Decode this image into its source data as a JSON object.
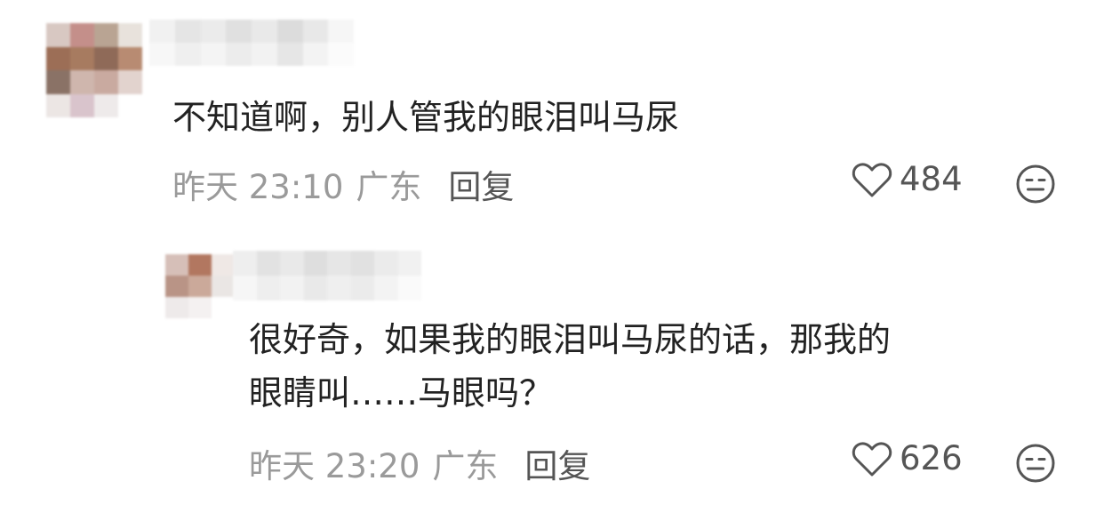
{
  "comments": [
    {
      "text": "不知道啊，别人管我的眼泪叫马尿",
      "time": "昨天 23:10",
      "location": "广东",
      "reply_label": "回复",
      "likes": "484"
    },
    {
      "text_line1": "很好奇，如果我的眼泪叫马尿的话，那我的",
      "text_line2": "眼睛叫……马眼吗？",
      "time": "昨天 23:20",
      "location": "广东",
      "reply_label": "回复",
      "likes": "626"
    }
  ],
  "icons": {
    "like": "heart-outline-icon",
    "emoji": "neutral-face-icon"
  },
  "colors": {
    "text": "#222222",
    "meta": "#9a9a9a",
    "action": "#555555"
  }
}
